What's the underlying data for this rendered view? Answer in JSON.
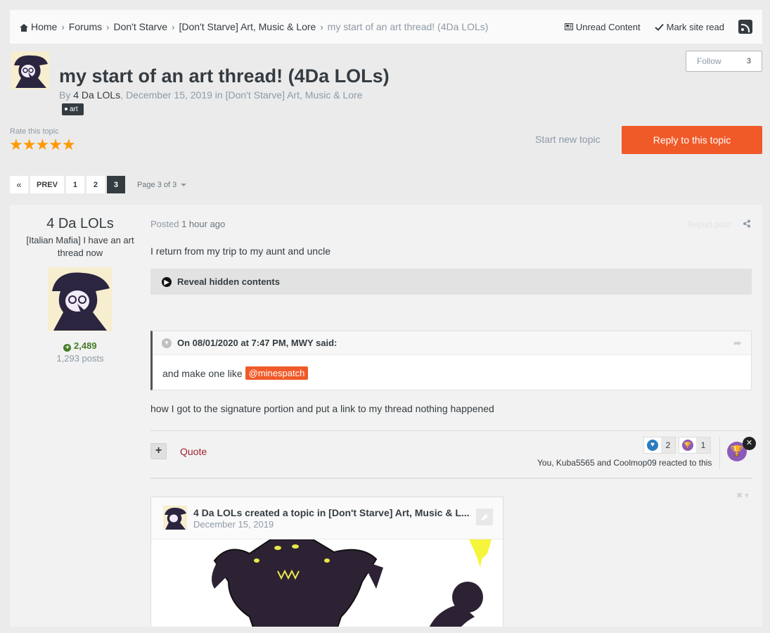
{
  "breadcrumb": {
    "items": [
      "Home",
      "Forums",
      "Don't Starve",
      "[Don't Starve] Art, Music & Lore"
    ],
    "current": "my start of an art thread! (4Da LOLs)",
    "unread": "Unread Content",
    "mark_read": "Mark site read"
  },
  "topic": {
    "title": "my start of an art thread! (4Da LOLs)",
    "by_prefix": "By ",
    "author": "4 Da LOLs",
    "date_text": ", December 15, 2019 in [Don't Starve] Art, Music & Lore",
    "tag": "art",
    "follow_label": "Follow",
    "follow_count": "3",
    "rate_label": "Rate this topic",
    "rating": 5,
    "stars": "★★★★★",
    "start_new": "Start new topic",
    "reply": "Reply to this topic"
  },
  "pagination": {
    "first": "«",
    "prev": "PREV",
    "pages": [
      "1",
      "2",
      "3"
    ],
    "current_page": "3",
    "page_of": "Page 3 of 3"
  },
  "post": {
    "author_name": "4 Da LOLs",
    "author_title": "[Italian Mafia] I have an art thread now",
    "reputation": "2,489",
    "post_count": "1,293 posts",
    "posted_prefix": "Posted ",
    "posted_time": "1 hour ago",
    "report": "Report post",
    "text1": "I return from my trip to my aunt and uncle",
    "reveal": "Reveal hidden contents",
    "quote_header": "On 08/01/2020 at 7:47 PM, MWY said:",
    "quote_text": "and make one like",
    "mention": "@minespatch",
    "text2": "how I got to the signature portion and put a link to my thread nothing happened",
    "quote_button": "Quote",
    "reaction_like_count": "2",
    "reaction_trophy_count": "1",
    "reaction_text": "You, Kuba5565 and Coolmop09 reacted to this"
  },
  "embed": {
    "title": "4 Da LOLs created a topic in [Don't Starve] Art, Music & L...",
    "date": "December 15, 2019"
  },
  "colors": {
    "accent": "#f05a28",
    "star": "#ff9900",
    "reputation": "#457c28",
    "quote_link": "#a0202d",
    "like": "#2c7dbf",
    "trophy": "#8e5ab8"
  }
}
